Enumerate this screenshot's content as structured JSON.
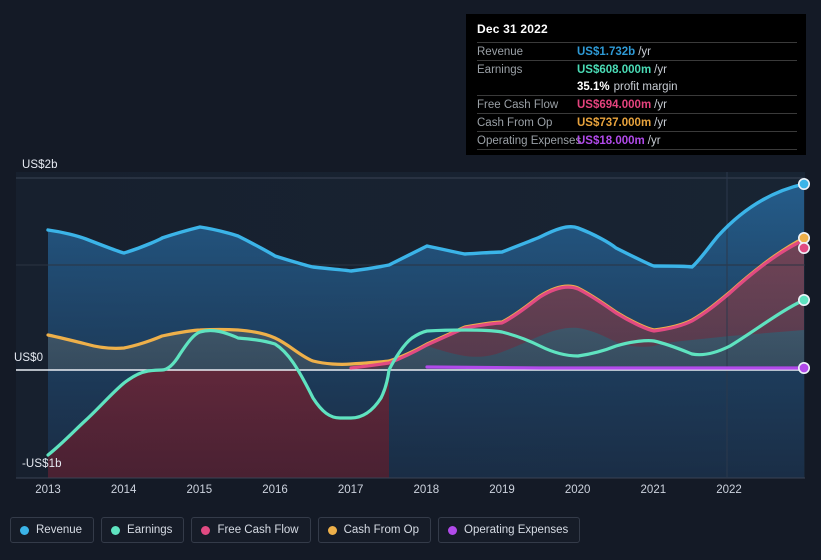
{
  "axes": {
    "y_labels": [
      "US$2b",
      "US$0",
      "-US$1b"
    ],
    "x_labels": [
      "2013",
      "2014",
      "2015",
      "2016",
      "2017",
      "2018",
      "2019",
      "2020",
      "2021",
      "2022"
    ]
  },
  "tooltip": {
    "date": "Dec 31 2022",
    "rows": [
      {
        "label": "Revenue",
        "value": "US$1.732b",
        "unit": "/yr",
        "color": "#2e9ad6"
      },
      {
        "label": "Earnings",
        "value": "US$608.000m",
        "unit": "/yr",
        "color": "#4adbb5"
      },
      {
        "label": "",
        "value": "35.1%",
        "unit": "",
        "sub": "profit margin",
        "color": "#ffffff"
      },
      {
        "label": "Free Cash Flow",
        "value": "US$694.000m",
        "unit": "/yr",
        "color": "#e4437e"
      },
      {
        "label": "Cash From Op",
        "value": "US$737.000m",
        "unit": "/yr",
        "color": "#e8a33d"
      },
      {
        "label": "Operating Expenses",
        "value": "US$18.000m",
        "unit": "/yr",
        "color": "#b14aea"
      }
    ]
  },
  "legend": [
    {
      "label": "Revenue",
      "color": "#3bb4e8"
    },
    {
      "label": "Earnings",
      "color": "#5fe3c0"
    },
    {
      "label": "Free Cash Flow",
      "color": "#e14a82"
    },
    {
      "label": "Cash From Op",
      "color": "#eeb04a"
    },
    {
      "label": "Operating Expenses",
      "color": "#b14aea"
    }
  ],
  "chart_data": {
    "type": "line",
    "title": "",
    "xlabel": "",
    "ylabel": "",
    "ylim": [
      -1.1,
      2.2
    ],
    "xlim": [
      2013,
      2022.75
    ],
    "grid": true,
    "legend_position": "bottom",
    "units": "US$ billions per year",
    "gridlines": [
      2.0,
      1.0,
      0.0
    ],
    "zero_line": 0.0,
    "x": [
      2013,
      2013.5,
      2014,
      2014.5,
      2015,
      2015.5,
      2016,
      2016.5,
      2017,
      2017.5,
      2018,
      2018.5,
      2019,
      2019.5,
      2020,
      2020.5,
      2021,
      2021.5,
      2022,
      2022.75
    ],
    "series": [
      {
        "name": "Revenue",
        "color": "#3bb4e8",
        "values": [
          1.41,
          1.37,
          1.3,
          1.34,
          1.44,
          1.4,
          1.28,
          1.19,
          1.17,
          1.2,
          1.31,
          1.26,
          1.26,
          1.33,
          1.45,
          1.38,
          1.27,
          1.3,
          1.56,
          1.732
        ]
      },
      {
        "name": "Earnings",
        "color": "#5fe3c0",
        "values": [
          -0.98,
          -0.7,
          -0.3,
          -0.06,
          0.23,
          0.31,
          0.25,
          -0.02,
          -0.28,
          -0.28,
          0.04,
          0.27,
          0.37,
          0.42,
          0.32,
          0.22,
          0.19,
          0.28,
          0.43,
          0.608
        ]
      },
      {
        "name": "Free Cash Flow",
        "color": "#e14a82",
        "values": [
          null,
          null,
          null,
          null,
          null,
          null,
          null,
          null,
          0.02,
          0.05,
          0.11,
          0.22,
          0.32,
          0.28,
          0.48,
          0.38,
          0.26,
          0.23,
          0.45,
          0.694
        ]
      },
      {
        "name": "Cash From Op",
        "color": "#eeb04a",
        "values": [
          0.33,
          0.29,
          0.21,
          0.26,
          0.36,
          0.38,
          0.38,
          0.24,
          0.05,
          0.07,
          0.13,
          0.24,
          0.34,
          0.3,
          0.5,
          0.41,
          0.29,
          0.25,
          0.48,
          0.737
        ]
      },
      {
        "name": "Operating Expenses",
        "color": "#b14aea",
        "values": [
          null,
          null,
          null,
          null,
          null,
          null,
          null,
          null,
          null,
          null,
          0.02,
          0.02,
          0.02,
          0.02,
          0.02,
          0.02,
          0.02,
          0.018,
          0.018,
          0.018
        ]
      }
    ]
  }
}
